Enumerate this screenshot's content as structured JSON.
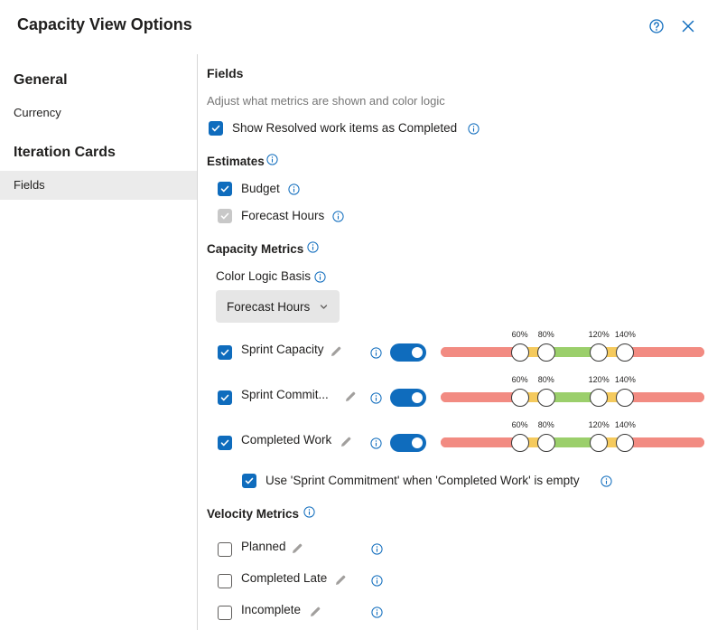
{
  "dialog": {
    "title": "Capacity View Options",
    "help_icon": "help-circle-icon",
    "close_icon": "close-icon"
  },
  "sidebar": {
    "sections": [
      {
        "heading": "General",
        "items": [
          {
            "label": "Currency",
            "selected": false
          }
        ]
      },
      {
        "heading": "Iteration Cards",
        "items": [
          {
            "label": "Fields",
            "selected": true
          }
        ]
      }
    ]
  },
  "fields": {
    "heading": "Fields",
    "subtitle": "Adjust what metrics are shown and color logic",
    "show_resolved": {
      "label": "Show Resolved work items as Completed",
      "checked": true
    }
  },
  "estimates": {
    "heading": "Estimates",
    "items": [
      {
        "label": "Budget",
        "checked": true,
        "disabled": false
      },
      {
        "label": "Forecast Hours",
        "checked": true,
        "disabled": true
      }
    ]
  },
  "capacity_metrics": {
    "heading": "Capacity Metrics",
    "color_logic_label": "Color Logic Basis",
    "color_logic_value": "Forecast Hours",
    "threshold_labels": [
      "60%",
      "80%",
      "120%",
      "140%"
    ],
    "thresholds": [
      60,
      80,
      120,
      140
    ],
    "range_colors": {
      "low": "#f28b82",
      "warn": "#f5ca5d",
      "ok": "#9bcf6b"
    },
    "metrics": [
      {
        "label": "Sprint Capacity",
        "checked": true,
        "enabled": true
      },
      {
        "label": "Sprint Commit...",
        "checked": true,
        "enabled": true
      },
      {
        "label": "Completed Work",
        "checked": true,
        "enabled": true
      }
    ],
    "use_commitment": {
      "label": "Use 'Sprint Commitment' when 'Completed Work' is empty",
      "checked": true
    }
  },
  "velocity_metrics": {
    "heading": "Velocity Metrics",
    "items": [
      {
        "label": "Planned",
        "checked": false
      },
      {
        "label": "Completed Late",
        "checked": false
      },
      {
        "label": "Incomplete",
        "checked": false
      }
    ]
  },
  "colors": {
    "accent": "#0f6cbd",
    "sidebar_selected": "#ebebeb"
  }
}
